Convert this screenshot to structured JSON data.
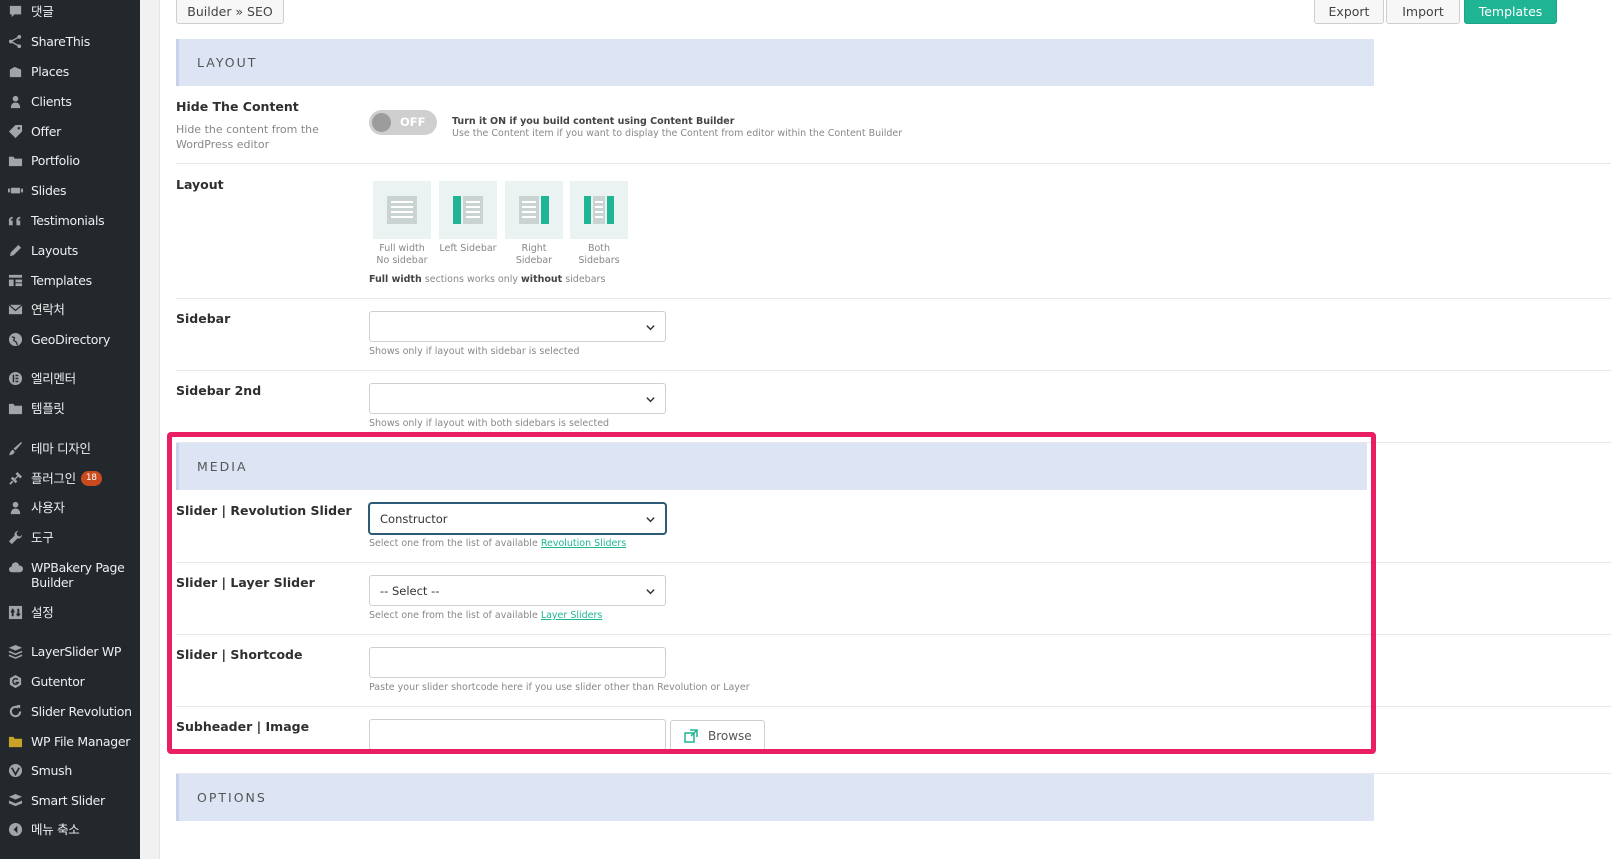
{
  "sidebar": {
    "items": [
      {
        "label": "댓글",
        "icon": "comment-icon"
      },
      {
        "label": "ShareThis",
        "icon": "share-icon"
      },
      {
        "label": "Places",
        "icon": "places-icon"
      },
      {
        "label": "Clients",
        "icon": "user-icon"
      },
      {
        "label": "Offer",
        "icon": "tag-icon"
      },
      {
        "label": "Portfolio",
        "icon": "portfolio-icon"
      },
      {
        "label": "Slides",
        "icon": "slides-icon"
      },
      {
        "label": "Testimonials",
        "icon": "quote-icon"
      },
      {
        "label": "Layouts",
        "icon": "pencil-icon"
      },
      {
        "label": "Templates",
        "icon": "templates-icon"
      },
      {
        "label": "연락처",
        "icon": "mail-icon"
      },
      {
        "label": "GeoDirectory",
        "icon": "globe-icon"
      },
      {
        "label": "엘리멘터",
        "icon": "elementor-icon"
      },
      {
        "label": "템플릿",
        "icon": "folder-icon"
      },
      {
        "label": "테마 디자인",
        "icon": "brush-icon"
      },
      {
        "label": "플러그인",
        "icon": "plugin-icon",
        "badge": "18"
      },
      {
        "label": "사용자",
        "icon": "user-icon"
      },
      {
        "label": "도구",
        "icon": "wrench-icon"
      },
      {
        "label": "WPBakery Page Builder",
        "icon": "cloud-icon"
      },
      {
        "label": "설정",
        "icon": "settings-icon"
      },
      {
        "label": "LayerSlider WP",
        "icon": "layers-icon"
      },
      {
        "label": "Gutentor",
        "icon": "gutentor-icon"
      },
      {
        "label": "Slider Revolution",
        "icon": "refresh-icon"
      },
      {
        "label": "WP File Manager",
        "icon": "file-folder-icon"
      },
      {
        "label": "Smush",
        "icon": "smush-icon"
      },
      {
        "label": "Smart Slider",
        "icon": "stack-icon"
      },
      {
        "label": "메뉴 축소",
        "icon": "collapse-icon"
      }
    ]
  },
  "toolbar": {
    "breadcrumb": "Builder » SEO",
    "export_label": "Export",
    "import_label": "Import",
    "templates_label": "Templates"
  },
  "layout_section": {
    "title": "LAYOUT",
    "hide_content": {
      "label": "Hide The Content",
      "description": "Hide the content from the WordPress editor",
      "toggle_state": "OFF",
      "help_title": "Turn it ON if you build content using Content Builder",
      "help_text": "Use the Content item if you want to display the Content from editor within the Content Builder"
    },
    "layout": {
      "label": "Layout",
      "options": [
        {
          "line1": "Full width",
          "line2": "No sidebar"
        },
        {
          "line1": "Left Sidebar",
          "line2": ""
        },
        {
          "line1": "Right",
          "line2": "Sidebar"
        },
        {
          "line1": "Both",
          "line2": "Sidebars"
        }
      ],
      "note_bold1": "Full width",
      "note_mid": " sections works only ",
      "note_bold2": "without",
      "note_end": " sidebars"
    },
    "sidebar": {
      "label": "Sidebar",
      "value": "",
      "help": "Shows only if layout with sidebar is selected"
    },
    "sidebar2": {
      "label": "Sidebar 2nd",
      "value": "",
      "help": "Shows only if layout with both sidebars is selected"
    }
  },
  "media_section": {
    "title": "MEDIA",
    "revolution": {
      "label": "Slider | Revolution Slider",
      "value": "Constructor",
      "help_prefix": "Select one from the list of available ",
      "help_link": "Revolution Sliders"
    },
    "layer": {
      "label": "Slider | Layer Slider",
      "value": "-- Select --",
      "help_prefix": "Select one from the list of available ",
      "help_link": "Layer Sliders"
    },
    "shortcode": {
      "label": "Slider | Shortcode",
      "value": "",
      "help": "Paste your slider shortcode here if you use slider other than Revolution or Layer"
    },
    "subheader_image": {
      "label": "Subheader | Image",
      "value": "",
      "browse_label": "Browse"
    }
  },
  "options_section": {
    "title": "OPTIONS"
  },
  "colors": {
    "accent": "#1fb594",
    "highlight": "#e91e63",
    "section_bg": "#dde5f4",
    "sidebar_bg": "#23282d"
  }
}
